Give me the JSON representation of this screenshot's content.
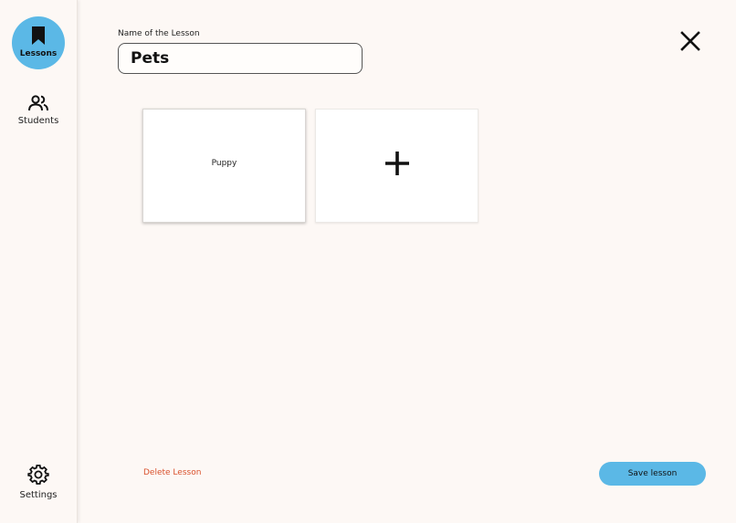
{
  "sidebar": {
    "items": [
      {
        "label": "Lessons",
        "icon": "bookmark-icon",
        "active": true
      },
      {
        "label": "Students",
        "icon": "people-icon",
        "active": false
      },
      {
        "label": "Settings",
        "icon": "gear-icon",
        "active": false
      }
    ]
  },
  "lesson": {
    "name_label": "Name of the Lesson",
    "name_value": "Pets"
  },
  "cards": [
    {
      "label": "Puppy"
    },
    {
      "label": "+",
      "icon": "plus-icon"
    }
  ],
  "actions": {
    "delete_label": "Delete Lesson",
    "save_label": "Save lesson",
    "close_icon": "close-icon"
  },
  "colors": {
    "accent": "#5bb8e6",
    "danger": "#d9512c",
    "background": "#fdf8f5"
  }
}
